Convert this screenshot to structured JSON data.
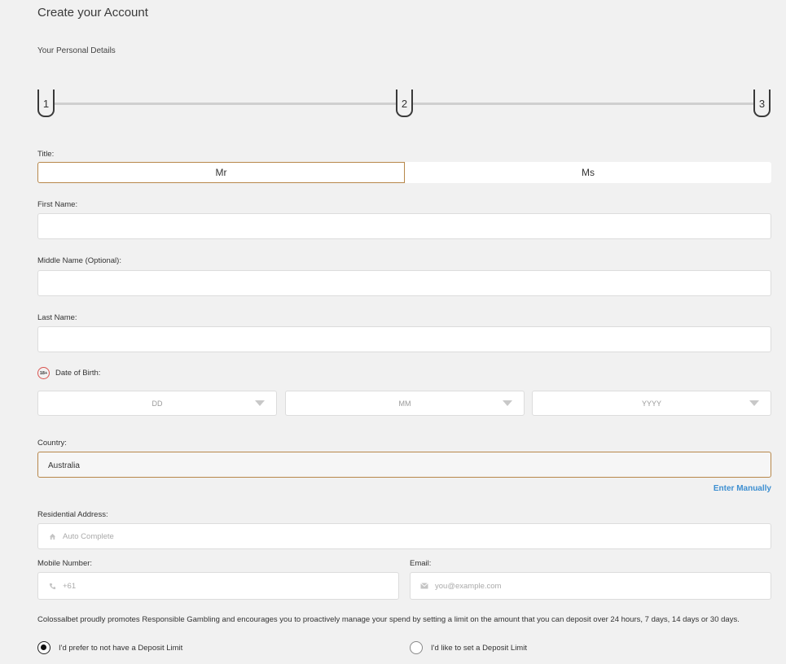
{
  "header": {
    "title": "Create your Account",
    "subtitle": "Your Personal Details"
  },
  "stepper": {
    "steps": [
      "1",
      "2",
      "3"
    ],
    "current": 1
  },
  "form": {
    "title_label": "Title:",
    "title_options": [
      "Mr",
      "Ms"
    ],
    "title_selected": "Mr",
    "first_name_label": "First Name:",
    "first_name_value": "",
    "middle_name_label": "Middle Name (Optional):",
    "middle_name_value": "",
    "last_name_label": "Last Name:",
    "last_name_value": "",
    "age_badge": "18+",
    "dob_label": "Date of Birth:",
    "dob_day_placeholder": "DD",
    "dob_month_placeholder": "MM",
    "dob_year_placeholder": "YYYY",
    "country_label": "Country:",
    "country_value": "Australia",
    "enter_manually": "Enter Manually",
    "address_label": "Residential Address:",
    "address_placeholder": "Auto Complete",
    "mobile_label": "Mobile Number:",
    "mobile_placeholder": "+61",
    "email_label": "Email:",
    "email_placeholder": "you@example.com",
    "responsible_text": "Colossalbet proudly promotes Responsible Gambling and encourages you to proactively manage your spend by setting a limit on the amount that you can deposit over 24 hours, 7 days, 14 days or 30 days.",
    "deposit_options": [
      "I'd prefer to not have a Deposit Limit",
      "I'd like to set a Deposit Limit"
    ],
    "deposit_selected": 0
  },
  "colors": {
    "accent_border": "#b7874a",
    "link": "#3d8fd1",
    "badge_red": "#d9534f"
  },
  "icons": {
    "address": "home-icon",
    "mobile": "phone-icon",
    "email": "envelope-icon"
  }
}
